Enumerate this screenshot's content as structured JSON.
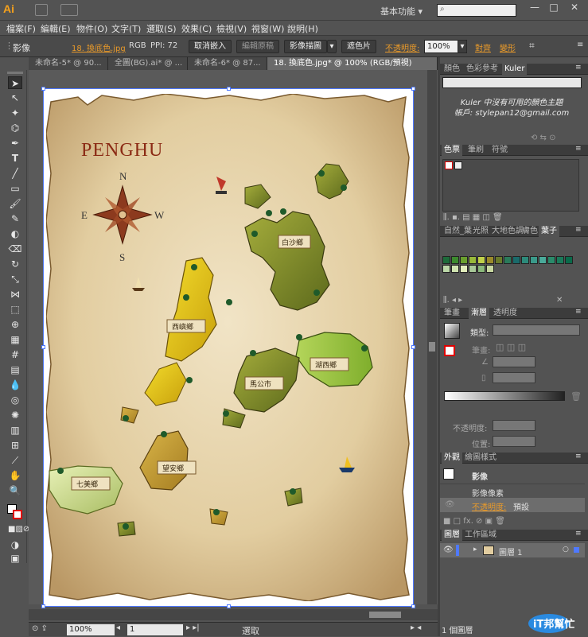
{
  "app": {
    "logo": "Ai",
    "workspace": "基本功能",
    "workspace_arrow": "▾",
    "search_placeholder": ""
  },
  "window_buttons": [
    "—",
    "□",
    "✕"
  ],
  "menus": [
    "檔案(F)",
    "編輯(E)",
    "物件(O)",
    "文字(T)",
    "選取(S)",
    "效果(C)",
    "檢視(V)",
    "視窗(W)",
    "說明(H)"
  ],
  "control": {
    "label": "影像",
    "file": "18. 換底色.jpg",
    "mode": "RGB",
    "ppi": "PPI: 72",
    "unembed": "取消嵌入",
    "edit_original": "編輯原稿",
    "trace": "影像描圖",
    "mask": "遮色片",
    "opacity_label": "不透明度:",
    "opacity_value": "100%",
    "align": "對齊",
    "transform": "變形"
  },
  "doc_tabs": [
    "未命名-5* @ 90...",
    "全圖(BG).ai* @ ...",
    "未命名-6* @ 87...",
    "18. 換底色.jpg* @ 100% (RGB/預視)"
  ],
  "map": {
    "title": "PENGHU",
    "compass": {
      "n": "N",
      "s": "S",
      "e": "E",
      "w": "W"
    },
    "labels": [
      "白沙鄉",
      "西嶼鄉",
      "湖西鄉",
      "馬公市",
      "望安鄉",
      "七美鄉"
    ]
  },
  "status": {
    "zoom": "100%",
    "page": "1",
    "text": "選取"
  },
  "panels": {
    "kuler_tabs": [
      "顏色",
      "色彩參考",
      "Kuler"
    ],
    "kuler_message": [
      "Kuler 中沒有可用的顏色主題",
      "帳戶: stylepan12@gmail.com"
    ],
    "swatch_tabs": [
      "色票",
      "筆刷",
      "符號"
    ],
    "lib_tabs": [
      "自然_葉",
      "光照",
      "大地色調",
      "膚色",
      "葉子"
    ],
    "stroke_tabs": [
      "筆畫",
      "漸層",
      "透明度"
    ],
    "gradient": {
      "type_label": "類型:",
      "stroke_label": "筆畫:",
      "opacity_label": "不透明度:",
      "position_label": "位置:"
    },
    "appearance_tabs": [
      "外觀",
      "繪圖樣式"
    ],
    "appearance": {
      "title": "影像",
      "row1": "影像像素",
      "row2_label": "不透明度:",
      "row2_value": "預設"
    },
    "layers_tabs": [
      "圖層",
      "工作區域"
    ],
    "layer_name": "圖層 1",
    "layer_count": "1 個圖層"
  },
  "watermark": {
    "text": "iT邦幫忙"
  },
  "colors": {
    "accent": "#e99a2a",
    "panel": "#535353",
    "selection": "#4f79ff"
  }
}
